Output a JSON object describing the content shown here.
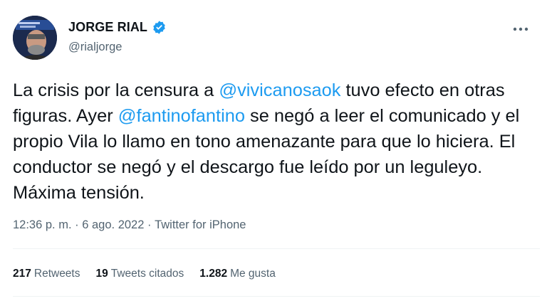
{
  "author": {
    "name": "JORGE RIAL",
    "handle": "@rialjorge",
    "avatar_icon": "avatar-photo",
    "verified_icon": "verified-badge-icon",
    "verified_color": "#1d9bf0"
  },
  "more_icon": "ellipsis-icon",
  "tweet": {
    "part1": "La crisis por la censura a ",
    "mention1": "@vivicanosaok",
    "part2": " tuvo efecto en otras figuras. Ayer ",
    "mention2": "@fantinofantino",
    "part3": " se negó a leer el comunicado y el propio Vila lo llamo en tono amenazante para que lo hiciera. El conductor se negó y el descargo fue leído por un leguleyo. Máxima tensión."
  },
  "meta": {
    "time": "12:36 p. m.",
    "sep1": " · ",
    "date": "6 ago. 2022",
    "sep2": " · ",
    "source": "Twitter for iPhone"
  },
  "stats": [
    {
      "num": "217",
      "label": "Retweets"
    },
    {
      "num": "19",
      "label": "Tweets citados"
    },
    {
      "num": "1.282",
      "label": "Me gusta"
    }
  ],
  "colors": {
    "link": "#1d9bf0",
    "secondary_text": "#536471",
    "primary_text": "#0f1419"
  }
}
